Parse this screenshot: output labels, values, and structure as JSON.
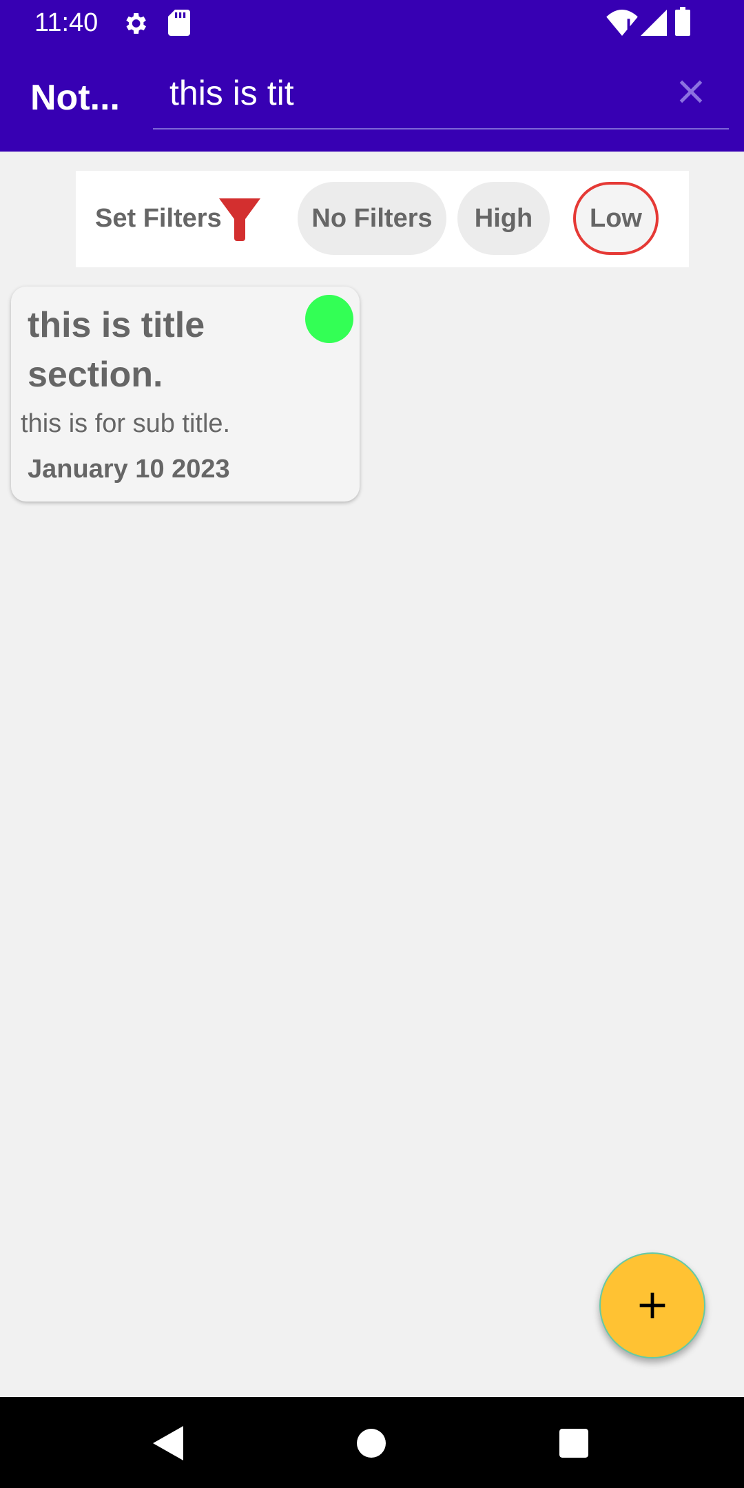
{
  "status_bar": {
    "time": "11:40",
    "left_icons": [
      "settings-icon",
      "sd-card-icon"
    ],
    "right_icons": [
      "wifi-alert-icon",
      "signal-icon",
      "battery-icon"
    ]
  },
  "app_bar": {
    "title": "Not...",
    "search": {
      "value": "this is tit"
    },
    "close_icon": "close-icon",
    "color": "#3700b3"
  },
  "filters": {
    "label": "Set Filters",
    "icon": "funnel-icon",
    "chips": [
      {
        "label": "No Filters",
        "selected": false
      },
      {
        "label": "High",
        "selected": false
      },
      {
        "label": "Low",
        "selected": true
      }
    ]
  },
  "notes": [
    {
      "title": "this is title section.",
      "subtitle": "this is for sub title.",
      "date": "January 10 2023",
      "priority_color": "#33ff55"
    }
  ],
  "fab": {
    "icon": "add-icon",
    "color": "#ffc233"
  },
  "nav_bar": {
    "icons": [
      "back-icon",
      "home-icon",
      "recents-icon"
    ]
  }
}
